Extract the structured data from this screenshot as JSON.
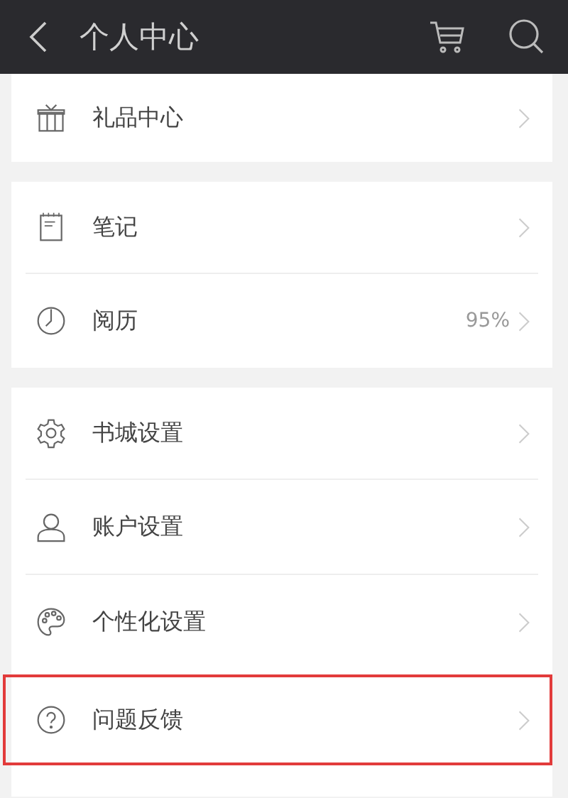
{
  "header": {
    "title": "个人中心"
  },
  "groups": [
    {
      "items": [
        {
          "kind": "gift",
          "label": "礼品中心",
          "highlighted": false
        }
      ]
    },
    {
      "items": [
        {
          "kind": "note",
          "label": "笔记",
          "highlighted": false
        },
        {
          "kind": "clock",
          "label": "阅历",
          "value": "95%",
          "highlighted": false
        }
      ]
    },
    {
      "items": [
        {
          "kind": "gear",
          "label": "书城设置",
          "highlighted": false
        },
        {
          "kind": "person",
          "label": "账户设置",
          "highlighted": false
        },
        {
          "kind": "palette",
          "label": "个性化设置",
          "highlighted": false
        },
        {
          "kind": "question",
          "label": "问题反馈",
          "highlighted": true
        }
      ]
    }
  ]
}
